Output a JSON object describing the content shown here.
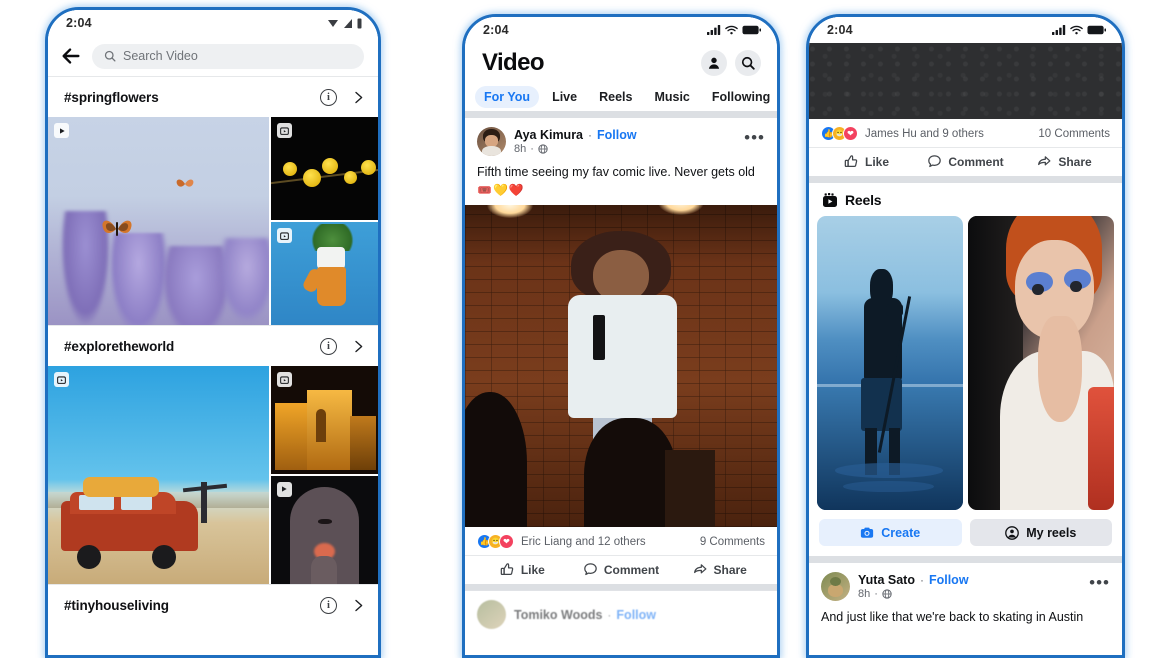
{
  "phones": {
    "left": {
      "status": {
        "time": "2:04",
        "icons": [
          "wifi-icon",
          "signal-icon",
          "battery-icon"
        ]
      },
      "search": {
        "placeholder": "Search Video",
        "back_label": "Back",
        "icon": "search-icon"
      },
      "sections": [
        {
          "hashtag": "#springflowers",
          "info_label": "i",
          "chevron_label": "›"
        },
        {
          "hashtag": "#exploretheworld",
          "info_label": "i",
          "chevron_label": "›"
        },
        {
          "hashtag": "#tinyhouseliving",
          "info_label": "i",
          "chevron_label": "›"
        }
      ],
      "grids": [
        {
          "big_alt": "butterfly-on-lavender",
          "cells": [
            "yellow-forsythia-night",
            "yoga-plant-pose-blue"
          ]
        },
        {
          "big_alt": "red-suv-desert-road-trip",
          "cells": [
            "lit-fort-at-night",
            "archway-silhouette"
          ]
        }
      ]
    },
    "middle": {
      "status": {
        "time": "2:04",
        "icons": [
          "signal-icon",
          "wifi-icon",
          "battery-icon"
        ]
      },
      "header": {
        "title": "Video",
        "profile_icon": "person-icon",
        "search_icon": "search-icon"
      },
      "tabs": [
        {
          "label": "For You",
          "active": true
        },
        {
          "label": "Live",
          "active": false
        },
        {
          "label": "Reels",
          "active": false
        },
        {
          "label": "Music",
          "active": false
        },
        {
          "label": "Following",
          "active": false
        }
      ],
      "post": {
        "author": "Aya Kimura",
        "separator": "·",
        "follow_label": "Follow",
        "time": "8h",
        "time_sep": "·",
        "privacy_icon": "globe-icon",
        "menu_label": "•••",
        "text": "Fifth time seeing my fav comic live. Never gets old",
        "emoji": "🎟️💛❤️",
        "media_alt": "comedian-on-stage-with-microphone",
        "reactions": {
          "names": "Eric Liang and 12 others",
          "comments": "9 Comments"
        },
        "actions": [
          {
            "label": "Like",
            "icon": "thumbs-up-icon"
          },
          {
            "label": "Comment",
            "icon": "comment-bubble-icon"
          },
          {
            "label": "Share",
            "icon": "share-arrow-icon"
          }
        ]
      },
      "next_post": {
        "author": "Tomiko Woods",
        "separator": "·",
        "follow_label": "Follow"
      }
    },
    "right": {
      "status": {
        "time": "2:04",
        "icons": [
          "signal-icon",
          "wifi-icon",
          "battery-icon"
        ]
      },
      "top_post": {
        "media_alt": "dark-asphalt-video",
        "reactions": {
          "names": "James Hu and 9 others",
          "comments": "10 Comments"
        },
        "actions": [
          {
            "label": "Like",
            "icon": "thumbs-up-icon"
          },
          {
            "label": "Comment",
            "icon": "comment-bubble-icon"
          },
          {
            "label": "Share",
            "icon": "share-arrow-icon"
          }
        ]
      },
      "reels": {
        "title": "Reels",
        "icon": "reels-clapper-icon",
        "items": [
          {
            "alt": "silhouette-paddleboarder-at-sunset"
          },
          {
            "alt": "person-applying-blue-eyeshadow"
          }
        ],
        "buttons": [
          {
            "label": "Create",
            "icon": "camera-icon",
            "style": "primary"
          },
          {
            "label": "My reels",
            "icon": "person-circle-icon",
            "style": "secondary"
          }
        ]
      },
      "bottom_post": {
        "author": "Yuta Sato",
        "separator": "·",
        "follow_label": "Follow",
        "time": "8h",
        "time_sep": "·",
        "privacy_icon": "globe-icon",
        "menu_label": "•••",
        "text": "And just like that we're back to skating in Austin"
      }
    }
  },
  "colors": {
    "accent_blue": "#1877f2",
    "frame_blue": "#1f6fc0",
    "tab_pill": "#e7f0fd",
    "divider": "#dcdfe3",
    "text_primary": "#0f1114",
    "text_secondary": "#5b5f66"
  }
}
